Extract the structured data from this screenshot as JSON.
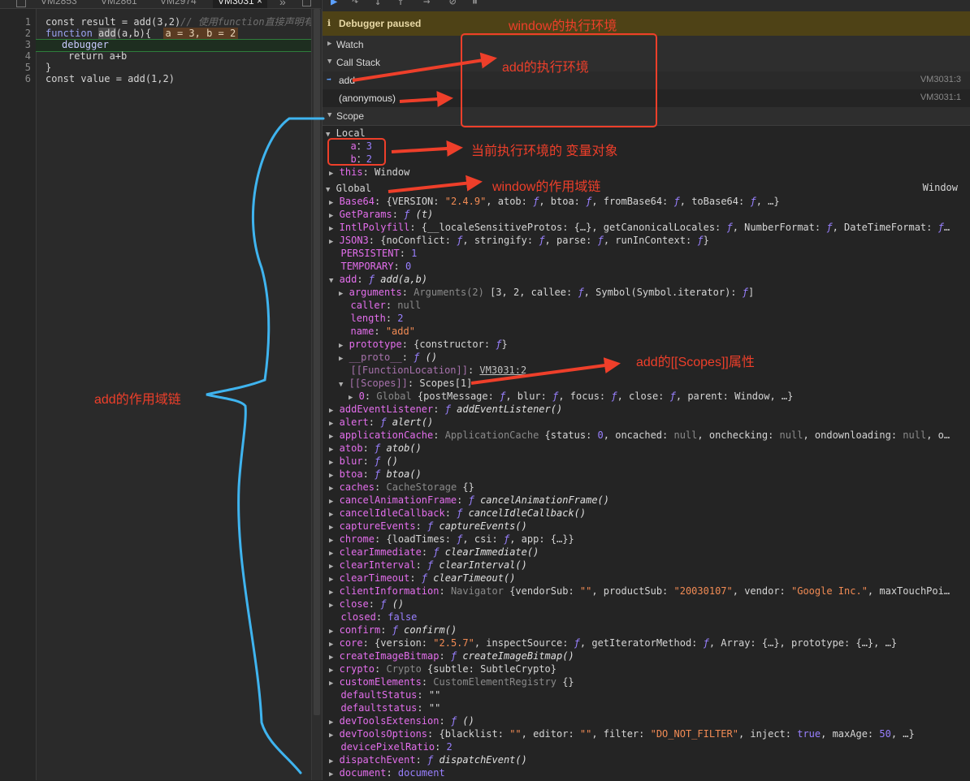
{
  "tabs": [
    "VM2853",
    "VM2861",
    "VM2974",
    "VM3031"
  ],
  "active_tab_close": "×",
  "tab_overflow": "»",
  "editor": {
    "line_numbers": [
      "1",
      "2",
      "3",
      "4",
      "5",
      "6"
    ],
    "line1_code": "const result = add(3,2)",
    "line1_comment": "// 使用function直接声明有",
    "line2_prefix": "function ",
    "line2_fn": "add",
    "line2_args": "(a,b){  ",
    "line2_inline": "a = 3, b = 2",
    "line3": "debugger",
    "line4": "return a+b",
    "line5": "}",
    "line6": "const value = add(1,2)"
  },
  "debugger": {
    "paused_label": "Debugger paused",
    "watch_label": "Watch",
    "callstack_label": "Call Stack",
    "frames": [
      {
        "name": "add",
        "location": "VM3031:3"
      },
      {
        "name": "(anonymous)",
        "location": "VM3031:1"
      }
    ],
    "scope_label": "Scope",
    "local_label": "Local",
    "global_label": "Global",
    "global_value": "Window"
  },
  "scope_rows": [
    {
      "segs": [
        [
          "pk",
          "a"
        ],
        [
          "",
          "："
        ],
        [
          "num",
          "3"
        ]
      ]
    },
    {
      "segs": [
        [
          "pk",
          "b"
        ],
        [
          "",
          "："
        ],
        [
          "num",
          "2"
        ]
      ]
    },
    {
      "segs": [
        [
          "pk",
          "this"
        ],
        [
          "",
          ": Window"
        ]
      ]
    },
    {
      "segs": [
        [
          "pk",
          "Base64"
        ],
        [
          "",
          ": {VERSION: "
        ],
        [
          "str",
          "\"2.4.9\""
        ],
        [
          "",
          ", atob: "
        ],
        [
          "f",
          "ƒ"
        ],
        [
          "",
          ", btoa: "
        ],
        [
          "f",
          "ƒ"
        ],
        [
          "",
          ", fromBase64: "
        ],
        [
          "f",
          "ƒ"
        ],
        [
          "",
          ", toBase64: "
        ],
        [
          "f",
          "ƒ"
        ],
        [
          "",
          ", …}"
        ]
      ]
    },
    {
      "segs": [
        [
          "pk",
          "GetParams"
        ],
        [
          "",
          ": "
        ],
        [
          "f",
          "ƒ"
        ],
        [
          "it",
          " (t)"
        ]
      ]
    },
    {
      "segs": [
        [
          "pk",
          "IntlPolyfill"
        ],
        [
          "",
          ": {__localeSensitiveProtos: {…}, getCanonicalLocales: "
        ],
        [
          "f",
          "ƒ"
        ],
        [
          "",
          ", NumberFormat: "
        ],
        [
          "f",
          "ƒ"
        ],
        [
          "",
          ", DateTimeFormat: "
        ],
        [
          "f",
          "ƒ"
        ],
        [
          "",
          "…"
        ]
      ]
    },
    {
      "segs": [
        [
          "pk",
          "JSON3"
        ],
        [
          "",
          ": {noConflict: "
        ],
        [
          "f",
          "ƒ"
        ],
        [
          "",
          ", stringify: "
        ],
        [
          "f",
          "ƒ"
        ],
        [
          "",
          ", parse: "
        ],
        [
          "f",
          "ƒ"
        ],
        [
          "",
          ", runInContext: "
        ],
        [
          "f",
          "ƒ"
        ],
        [
          "",
          "}"
        ]
      ]
    },
    {
      "segs": [
        [
          "pk",
          "PERSISTENT"
        ],
        [
          "",
          ": "
        ],
        [
          "num",
          "1"
        ]
      ]
    },
    {
      "segs": [
        [
          "pk",
          "TEMPORARY"
        ],
        [
          "",
          ": "
        ],
        [
          "num",
          "0"
        ]
      ]
    },
    {
      "segs": [
        [
          "pk",
          "add"
        ],
        [
          "",
          ": "
        ],
        [
          "f",
          "ƒ"
        ],
        [
          "it",
          " add(a,b)"
        ]
      ]
    },
    {
      "segs": [
        [
          "pk",
          "arguments"
        ],
        [
          "",
          ": "
        ],
        [
          "cls",
          "Arguments(2)"
        ],
        [
          "",
          " [3, 2, callee: "
        ],
        [
          "f",
          "ƒ"
        ],
        [
          "",
          ", Symbol(Symbol.iterator): "
        ],
        [
          "f",
          "ƒ"
        ],
        [
          "",
          "]"
        ]
      ]
    },
    {
      "segs": [
        [
          "pk",
          "caller"
        ],
        [
          "",
          ": "
        ],
        [
          "nul",
          "null"
        ]
      ]
    },
    {
      "segs": [
        [
          "pk",
          "length"
        ],
        [
          "",
          ": "
        ],
        [
          "num",
          "2"
        ]
      ]
    },
    {
      "segs": [
        [
          "pk",
          "name"
        ],
        [
          "",
          ": "
        ],
        [
          "str",
          "\"add\""
        ]
      ]
    },
    {
      "segs": [
        [
          "pk",
          "prototype"
        ],
        [
          "",
          ": {constructor: "
        ],
        [
          "f",
          "ƒ"
        ],
        [
          "",
          "}"
        ]
      ]
    },
    {
      "segs": [
        [
          "pkd",
          "__proto__"
        ],
        [
          "",
          ": "
        ],
        [
          "f",
          "ƒ"
        ],
        [
          "it",
          " ()"
        ]
      ]
    },
    {
      "segs": [
        [
          "pkd",
          "[[FunctionLocation]]"
        ],
        [
          "",
          ": "
        ],
        [
          "link",
          "VM3031:2"
        ]
      ]
    },
    {
      "segs": [
        [
          "pkd",
          "[[Scopes]]"
        ],
        [
          "",
          ": Scopes[1]"
        ]
      ]
    },
    {
      "segs": [
        [
          "pk",
          "0"
        ],
        [
          "",
          ": "
        ],
        [
          "cls",
          "Global"
        ],
        [
          "",
          " {postMessage: "
        ],
        [
          "f",
          "ƒ"
        ],
        [
          "",
          ", blur: "
        ],
        [
          "f",
          "ƒ"
        ],
        [
          "",
          ", focus: "
        ],
        [
          "f",
          "ƒ"
        ],
        [
          "",
          ", close: "
        ],
        [
          "f",
          "ƒ"
        ],
        [
          "",
          ", parent: Window, …}"
        ]
      ]
    },
    {
      "segs": [
        [
          "pk",
          "addEventListener"
        ],
        [
          "",
          ": "
        ],
        [
          "f",
          "ƒ"
        ],
        [
          "it",
          " addEventListener()"
        ]
      ]
    },
    {
      "segs": [
        [
          "pk",
          "alert"
        ],
        [
          "",
          ": "
        ],
        [
          "f",
          "ƒ"
        ],
        [
          "it",
          " alert()"
        ]
      ]
    },
    {
      "segs": [
        [
          "pk",
          "applicationCache"
        ],
        [
          "",
          ": "
        ],
        [
          "cls",
          "ApplicationCache"
        ],
        [
          "",
          " {status: "
        ],
        [
          "num",
          "0"
        ],
        [
          "",
          ", oncached: "
        ],
        [
          "nul",
          "null"
        ],
        [
          "",
          ", onchecking: "
        ],
        [
          "nul",
          "null"
        ],
        [
          "",
          ", ondownloading: "
        ],
        [
          "nul",
          "null"
        ],
        [
          "",
          ", o…"
        ]
      ]
    },
    {
      "segs": [
        [
          "pk",
          "atob"
        ],
        [
          "",
          ": "
        ],
        [
          "f",
          "ƒ"
        ],
        [
          "it",
          " atob()"
        ]
      ]
    },
    {
      "segs": [
        [
          "pk",
          "blur"
        ],
        [
          "",
          ": "
        ],
        [
          "f",
          "ƒ"
        ],
        [
          "it",
          " ()"
        ]
      ]
    },
    {
      "segs": [
        [
          "pk",
          "btoa"
        ],
        [
          "",
          ": "
        ],
        [
          "f",
          "ƒ"
        ],
        [
          "it",
          " btoa()"
        ]
      ]
    },
    {
      "segs": [
        [
          "pk",
          "caches"
        ],
        [
          "",
          ": "
        ],
        [
          "cls",
          "CacheStorage"
        ],
        [
          "",
          " {}"
        ]
      ]
    },
    {
      "segs": [
        [
          "pk",
          "cancelAnimationFrame"
        ],
        [
          "",
          ": "
        ],
        [
          "f",
          "ƒ"
        ],
        [
          "it",
          " cancelAnimationFrame()"
        ]
      ]
    },
    {
      "segs": [
        [
          "pk",
          "cancelIdleCallback"
        ],
        [
          "",
          ": "
        ],
        [
          "f",
          "ƒ"
        ],
        [
          "it",
          " cancelIdleCallback()"
        ]
      ]
    },
    {
      "segs": [
        [
          "pk",
          "captureEvents"
        ],
        [
          "",
          ": "
        ],
        [
          "f",
          "ƒ"
        ],
        [
          "it",
          " captureEvents()"
        ]
      ]
    },
    {
      "segs": [
        [
          "pk",
          "chrome"
        ],
        [
          "",
          ": {loadTimes: "
        ],
        [
          "f",
          "ƒ"
        ],
        [
          "",
          ", csi: "
        ],
        [
          "f",
          "ƒ"
        ],
        [
          "",
          ", app: {…}}"
        ]
      ]
    },
    {
      "segs": [
        [
          "pk",
          "clearImmediate"
        ],
        [
          "",
          ": "
        ],
        [
          "f",
          "ƒ"
        ],
        [
          "it",
          " clearImmediate()"
        ]
      ]
    },
    {
      "segs": [
        [
          "pk",
          "clearInterval"
        ],
        [
          "",
          ": "
        ],
        [
          "f",
          "ƒ"
        ],
        [
          "it",
          " clearInterval()"
        ]
      ]
    },
    {
      "segs": [
        [
          "pk",
          "clearTimeout"
        ],
        [
          "",
          ": "
        ],
        [
          "f",
          "ƒ"
        ],
        [
          "it",
          " clearTimeout()"
        ]
      ]
    },
    {
      "segs": [
        [
          "pk",
          "clientInformation"
        ],
        [
          "",
          ": "
        ],
        [
          "cls",
          "Navigator"
        ],
        [
          "",
          " {vendorSub: "
        ],
        [
          "str",
          "\"\""
        ],
        [
          "",
          ", productSub: "
        ],
        [
          "str",
          "\"20030107\""
        ],
        [
          "",
          ", vendor: "
        ],
        [
          "str",
          "\"Google Inc.\""
        ],
        [
          "",
          ", maxTouchPoi…"
        ]
      ]
    },
    {
      "segs": [
        [
          "pk",
          "close"
        ],
        [
          "",
          ": "
        ],
        [
          "f",
          "ƒ"
        ],
        [
          "it",
          " ()"
        ]
      ]
    },
    {
      "segs": [
        [
          "pk",
          "closed"
        ],
        [
          "",
          ": "
        ],
        [
          "bool",
          "false"
        ]
      ]
    },
    {
      "segs": [
        [
          "pk",
          "confirm"
        ],
        [
          "",
          ": "
        ],
        [
          "f",
          "ƒ"
        ],
        [
          "it",
          " confirm()"
        ]
      ]
    },
    {
      "segs": [
        [
          "pk",
          "core"
        ],
        [
          "",
          ": {version: "
        ],
        [
          "str",
          "\"2.5.7\""
        ],
        [
          "",
          ", inspectSource: "
        ],
        [
          "f",
          "ƒ"
        ],
        [
          "",
          ", getIteratorMethod: "
        ],
        [
          "f",
          "ƒ"
        ],
        [
          "",
          ", Array: {…}, prototype: {…}, …}"
        ]
      ]
    },
    {
      "segs": [
        [
          "pk",
          "createImageBitmap"
        ],
        [
          "",
          ": "
        ],
        [
          "f",
          "ƒ"
        ],
        [
          "it",
          " createImageBitmap()"
        ]
      ]
    },
    {
      "segs": [
        [
          "pk",
          "crypto"
        ],
        [
          "",
          ": "
        ],
        [
          "cls",
          "Crypto"
        ],
        [
          "",
          " {subtle: SubtleCrypto}"
        ]
      ]
    },
    {
      "segs": [
        [
          "pk",
          "customElements"
        ],
        [
          "",
          ": "
        ],
        [
          "cls",
          "CustomElementRegistry"
        ],
        [
          "",
          " {}"
        ]
      ]
    },
    {
      "segs": [
        [
          "pk",
          "defaultStatus"
        ],
        [
          "",
          ": \"\""
        ]
      ]
    },
    {
      "segs": [
        [
          "pk",
          "defaultstatus"
        ],
        [
          "",
          ": \"\""
        ]
      ]
    },
    {
      "segs": [
        [
          "pk",
          "devToolsExtension"
        ],
        [
          "",
          ": "
        ],
        [
          "f",
          "ƒ"
        ],
        [
          "it",
          " ()"
        ]
      ]
    },
    {
      "segs": [
        [
          "pk",
          "devToolsOptions"
        ],
        [
          "",
          ": {blacklist: "
        ],
        [
          "str",
          "\"\""
        ],
        [
          "",
          ", editor: "
        ],
        [
          "str",
          "\"\""
        ],
        [
          "",
          ", filter: "
        ],
        [
          "str",
          "\"DO_NOT_FILTER\""
        ],
        [
          "",
          ", inject: "
        ],
        [
          "bool",
          "true"
        ],
        [
          "",
          ", maxAge: "
        ],
        [
          "num",
          "50"
        ],
        [
          "",
          ", …}"
        ]
      ]
    },
    {
      "segs": [
        [
          "pk",
          "devicePixelRatio"
        ],
        [
          "",
          ": "
        ],
        [
          "num",
          "2"
        ]
      ]
    },
    {
      "segs": [
        [
          "pk",
          "dispatchEvent"
        ],
        [
          "",
          ": "
        ],
        [
          "f",
          "ƒ"
        ],
        [
          "it",
          " dispatchEvent()"
        ]
      ]
    },
    {
      "segs": [
        [
          "pk",
          "document"
        ],
        [
          "",
          ": "
        ],
        [
          "num",
          "document"
        ]
      ]
    }
  ],
  "annotations": {
    "window_ctx": "window的执行环境",
    "add_ctx": "add的执行环境",
    "var_obj": "当前执行环境的 变量对象",
    "window_scope_chain": "window的作用域链",
    "add_scopes": "add的[[Scopes]]属性",
    "add_scope_chain": "add的作用域链"
  }
}
